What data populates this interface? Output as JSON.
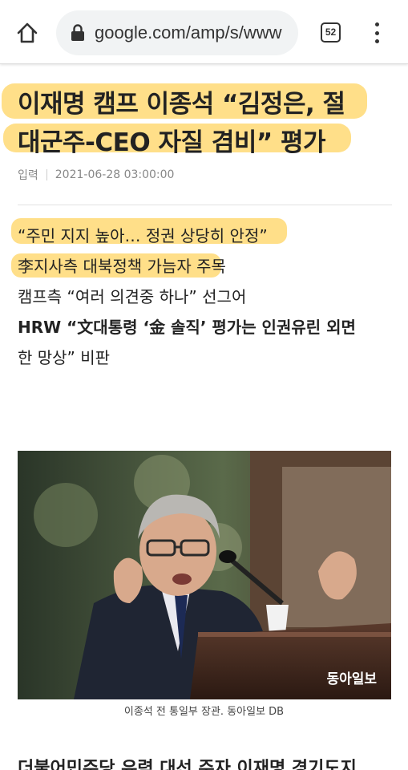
{
  "browser": {
    "url": "google.com/amp/s/www",
    "tab_count": "52",
    "icons": [
      "home-icon",
      "lock-icon",
      "tabs-icon",
      "more-vert-icon"
    ]
  },
  "article": {
    "headline_line1": "이재명 캠프 이종석 “김정은, 절",
    "headline_line2": "대군주-CEO 자질 겸비” 평가",
    "meta_label": "입력",
    "meta_date": "2021-06-28 03:00:00",
    "summary": [
      "“주민 지지 높아… 정권 상당히 안정”",
      "李지사측 대북정책 가늠자 주목",
      "캠프측 “여러 의견중 하나” 선그어",
      "HRW “文대통령 ‘金 솔직’ 평가는 인권유린 외면",
      "한 망상” 비판"
    ],
    "photo_watermark": "동아일보",
    "photo_caption": "이종석 전 통일부 장관. 동아일보 DB",
    "next_text": "더불어민주당 유력 대선 주자 이재명 경기도지"
  },
  "colors": {
    "highlighter": "#ffc428",
    "text": "#222222",
    "meta": "#888888",
    "urlbar_bg": "#f1f3f4"
  }
}
